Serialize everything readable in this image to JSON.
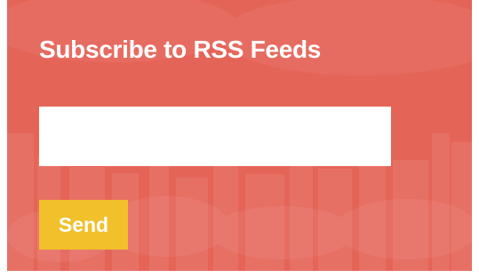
{
  "subscribe_widget": {
    "title": "Subscribe to RSS Feeds",
    "input_value": "",
    "send_label": "Send"
  },
  "colors": {
    "background": "#e56458",
    "button": "#f1c02a",
    "input": "#ffffff",
    "text": "#ffffff"
  }
}
